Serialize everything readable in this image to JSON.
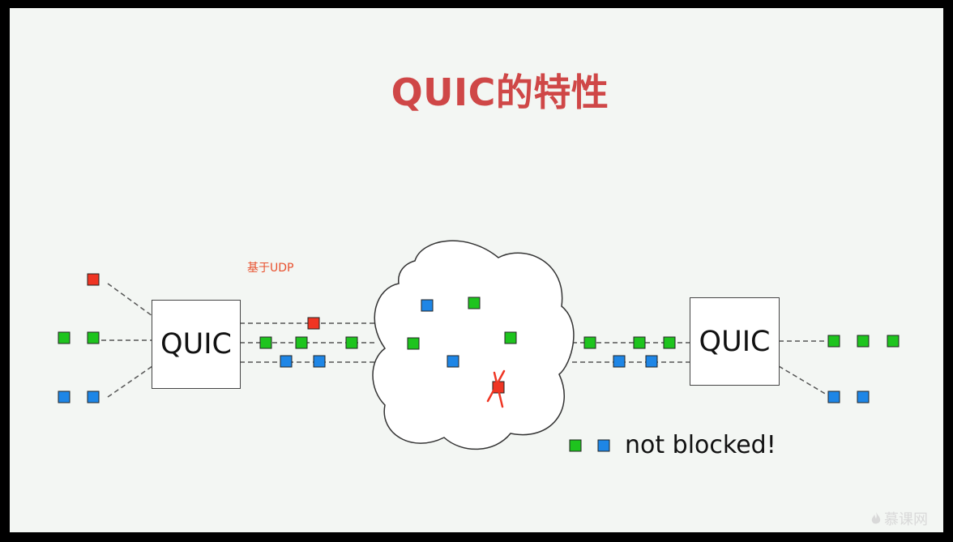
{
  "slide": {
    "title": "QUIC的特性",
    "title_color": "#cf4747",
    "udp_label": "基于UDP",
    "udp_label_color": "#e8502d"
  },
  "diagram": {
    "left_box_label": "QUIC",
    "right_box_label": "QUIC",
    "legend_text": "not blocked!",
    "colors": {
      "green_packet": "#1ec41e",
      "blue_packet": "#1e86e6",
      "red_packet": "#ef3523",
      "lost_mark": "#ef3523",
      "line": "#555555",
      "cloud_fill": "#ffffff",
      "cloud_stroke": "#333333"
    }
  },
  "watermark": {
    "text": "慕课网",
    "icon": "flame-icon"
  }
}
